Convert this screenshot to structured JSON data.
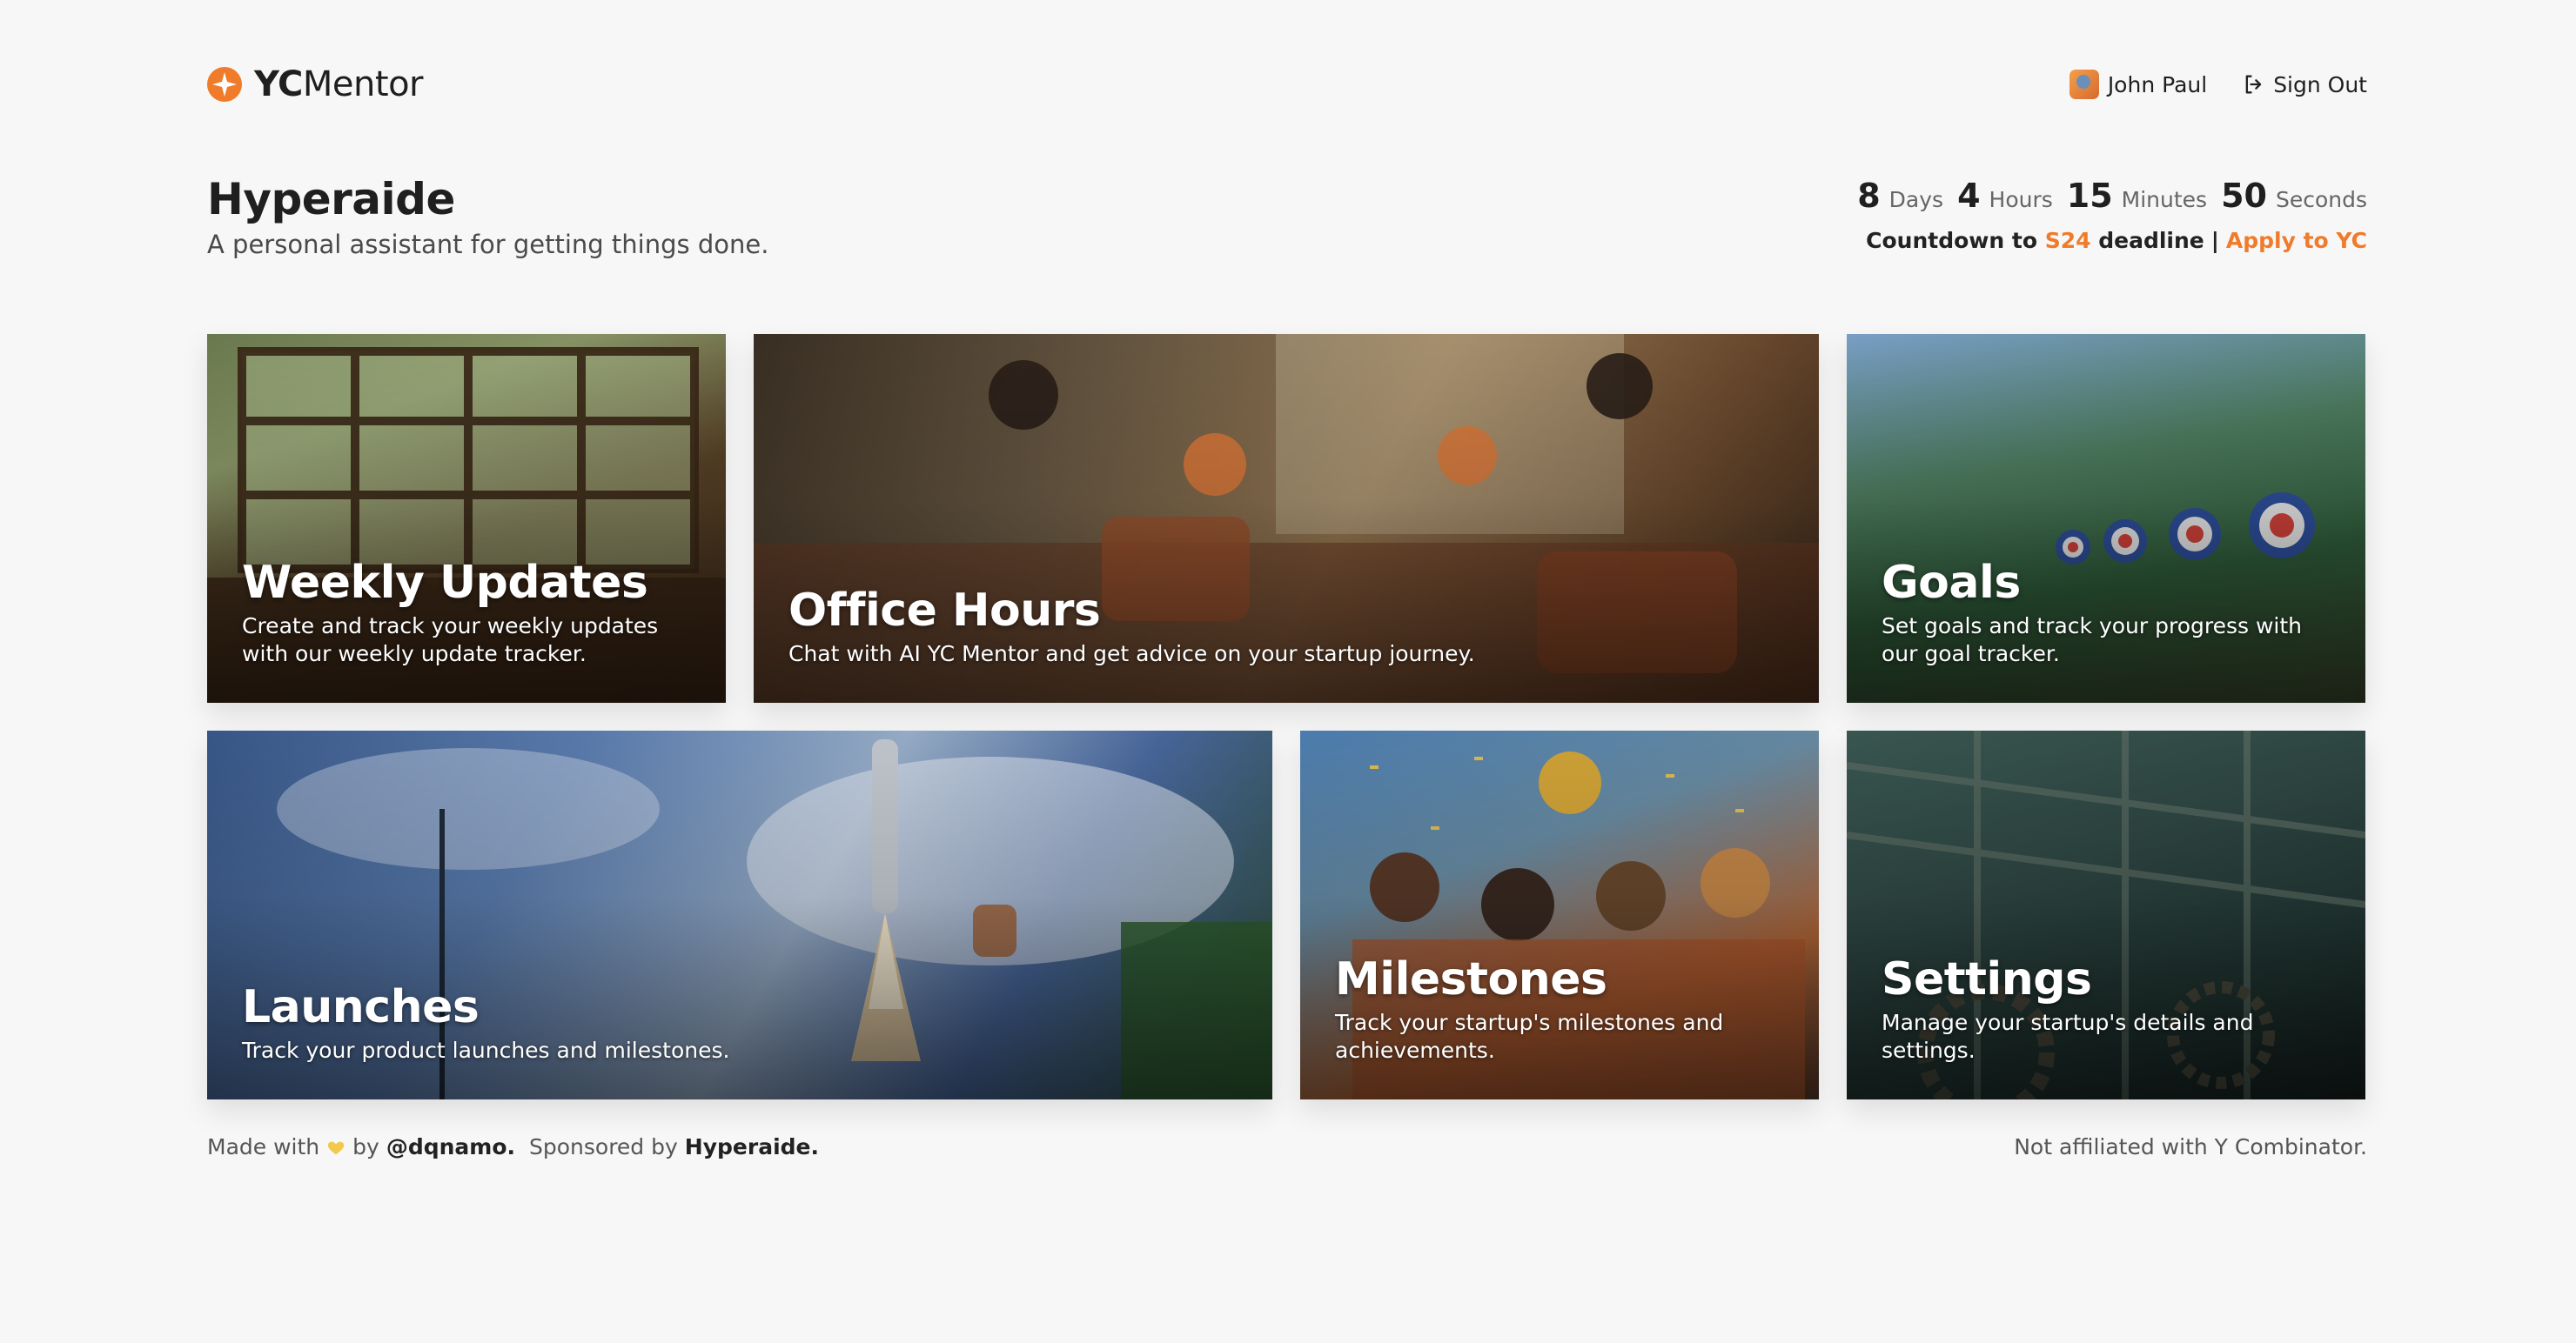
{
  "brand": {
    "bold": "YC",
    "light": "Mentor"
  },
  "user": {
    "name": "John Paul",
    "signout_label": "Sign Out"
  },
  "page": {
    "title": "Hyperaide",
    "subtitle": "A personal assistant for getting things done."
  },
  "countdown": {
    "days": "8",
    "days_label": "Days",
    "hours": "4",
    "hours_label": "Hours",
    "minutes": "15",
    "minutes_label": "Minutes",
    "seconds": "50",
    "seconds_label": "Seconds",
    "prefix": "Countdown to",
    "batch": "S24",
    "suffix": "deadline",
    "separator": "|",
    "apply_link": "Apply to YC"
  },
  "cards": {
    "weekly": {
      "title": "Weekly Updates",
      "desc": "Create and track your weekly updates with our weekly update tracker."
    },
    "office": {
      "title": "Office Hours",
      "desc": "Chat with AI YC Mentor and get advice on your startup journey."
    },
    "goals": {
      "title": "Goals",
      "desc": "Set goals and track your progress with our goal tracker."
    },
    "launches": {
      "title": "Launches",
      "desc": "Track your product launches and milestones."
    },
    "milestones": {
      "title": "Milestones",
      "desc": "Track your startup's milestones and achievements."
    },
    "settings": {
      "title": "Settings",
      "desc": "Manage your startup's details and settings."
    }
  },
  "footer": {
    "made_with": "Made with",
    "by": "by",
    "author": "@dqnamo.",
    "sponsored_by": "Sponsored by",
    "sponsor": "Hyperaide.",
    "disclaimer": "Not affiliated with Y Combinator."
  },
  "colors": {
    "accent": "#f07b2a",
    "background": "#f7f7f7"
  },
  "icons": {
    "logo": "yc-logo-icon",
    "signout": "signout-icon",
    "heart": "heart-icon"
  }
}
